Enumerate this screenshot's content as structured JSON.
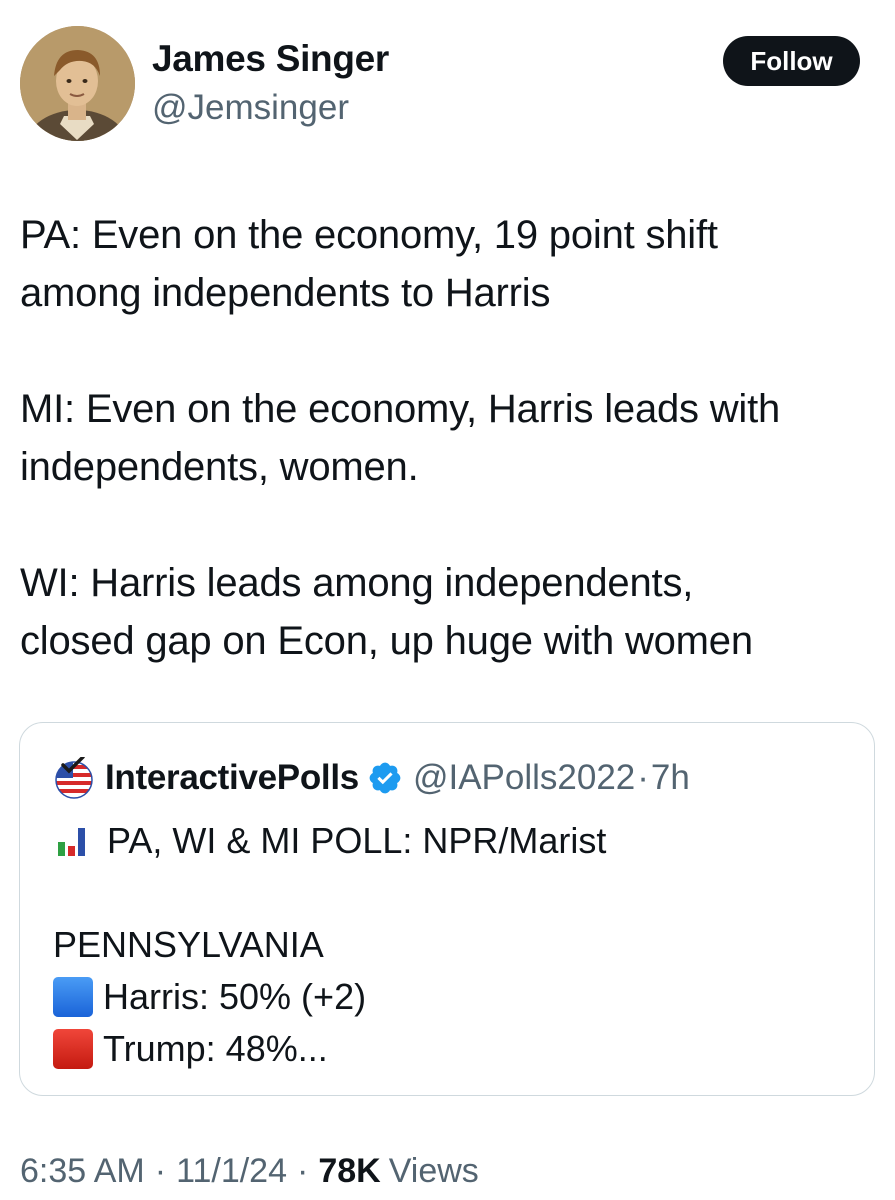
{
  "author": {
    "name": "James Singer",
    "handle": "@Jemsinger",
    "follow_label": "Follow",
    "avatar_icon": "portrait-photo"
  },
  "tweet": {
    "paragraphs": [
      "PA: Even on the economy, 19 point  shift\namong independents  to Harris",
      "MI: Even on the economy, Harris leads with\nindependents, women.",
      "WI: Harris leads among independents,\nclosed gap on Econ, up huge with women"
    ]
  },
  "quoted_tweet": {
    "name": "InteractivePolls",
    "handle": "@IAPolls2022",
    "separator": "·",
    "time": "7h",
    "verified": true,
    "verified_color": "#1d9bf0",
    "avatar_icon": "flag-ballot-icon",
    "lines": {
      "headline": "PA, WI & MI POLL: NPR/Marist",
      "state": "PENNSYLVANIA",
      "harris": "Harris: 50% (+2)",
      "trump": "Trump: 48%..."
    },
    "icons": {
      "headline": "bar-chart-icon",
      "harris": "blue-square-icon",
      "trump": "red-square-icon"
    }
  },
  "meta": {
    "time": "6:35 AM",
    "date": "11/1/24",
    "separator": "·",
    "views_count": "78K",
    "views_label": "Views"
  }
}
